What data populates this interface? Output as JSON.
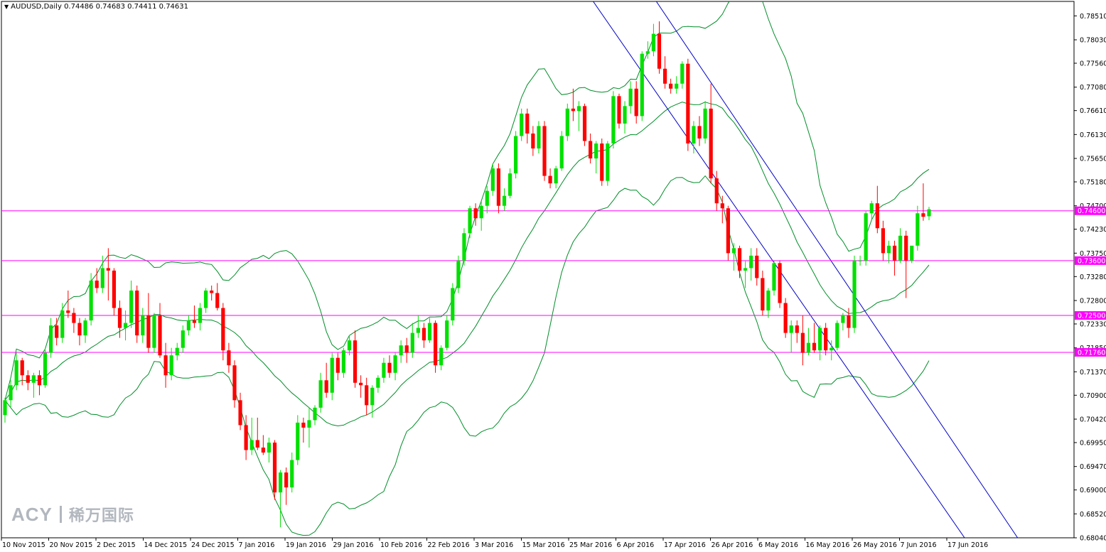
{
  "header": {
    "symbol": "AUDUSD,Daily",
    "ohlc": "0.74486 0.74683 0.74411 0.74631"
  },
  "watermark": {
    "brand": "ACY",
    "chinese": "稀万国际"
  },
  "colors": {
    "bull": "#00e000",
    "bear": "#ff0000",
    "band": "#008e28",
    "channel": "#0000c8",
    "level": "#ff00ff"
  },
  "chart_data": {
    "type": "candlestick",
    "title": "",
    "ylim": [
      0.6804,
      0.788
    ],
    "y_ticks": [
      "0.78510",
      "0.78030",
      "0.77560",
      "0.77080",
      "0.76610",
      "0.76130",
      "0.75650",
      "0.75180",
      "0.74700",
      "0.74230",
      "0.73750",
      "0.73280",
      "0.72800",
      "0.72330",
      "0.71850",
      "0.71370",
      "0.70900",
      "0.70420",
      "0.69950",
      "0.69470",
      "0.69000",
      "0.68520",
      "0.68040"
    ],
    "x_labels": [
      "10 Nov 2015",
      "20 Nov 2015",
      "2 Dec 2015",
      "14 Dec 2015",
      "24 Dec 2015",
      "7 Jan 2016",
      "19 Jan 2016",
      "29 Jan 2016",
      "10 Feb 2016",
      "22 Feb 2016",
      "3 Mar 2016",
      "15 Mar 2016",
      "25 Mar 2016",
      "6 Apr 2016",
      "17 Apr 2016",
      "26 Apr 2016",
      "6 May 2016",
      "16 May 2016",
      "26 May 2016",
      "7 Jun 2016",
      "17 Jun 2016"
    ],
    "horizontal_levels": [
      0.746,
      0.736,
      0.725,
      0.7176
    ],
    "level_labels": [
      "0.74600",
      "0.73600",
      "0.72500",
      "0.71760"
    ],
    "candles": [
      [
        0.705,
        0.7085,
        0.7035,
        0.708
      ],
      [
        0.708,
        0.712,
        0.7065,
        0.711
      ],
      [
        0.711,
        0.7175,
        0.71,
        0.716
      ],
      [
        0.716,
        0.7165,
        0.711,
        0.713
      ],
      [
        0.713,
        0.714,
        0.71,
        0.7115
      ],
      [
        0.7115,
        0.7135,
        0.7085,
        0.713
      ],
      [
        0.713,
        0.714,
        0.709,
        0.711
      ],
      [
        0.711,
        0.7185,
        0.7105,
        0.7175
      ],
      [
        0.7175,
        0.7245,
        0.7165,
        0.723
      ],
      [
        0.723,
        0.7245,
        0.719,
        0.7205
      ],
      [
        0.7205,
        0.7275,
        0.7195,
        0.726
      ],
      [
        0.726,
        0.73,
        0.7245,
        0.7255
      ],
      [
        0.7255,
        0.7265,
        0.7215,
        0.7235
      ],
      [
        0.7235,
        0.7245,
        0.719,
        0.721
      ],
      [
        0.721,
        0.7245,
        0.7195,
        0.724
      ],
      [
        0.724,
        0.7335,
        0.723,
        0.732
      ],
      [
        0.732,
        0.7345,
        0.7295,
        0.7305
      ],
      [
        0.7305,
        0.737,
        0.7295,
        0.7345
      ],
      [
        0.7345,
        0.7385,
        0.728,
        0.734
      ],
      [
        0.734,
        0.7345,
        0.725,
        0.7265
      ],
      [
        0.7265,
        0.728,
        0.7205,
        0.7225
      ],
      [
        0.7225,
        0.726,
        0.72,
        0.7235
      ],
      [
        0.7235,
        0.732,
        0.7225,
        0.73
      ],
      [
        0.73,
        0.731,
        0.7195,
        0.721
      ],
      [
        0.721,
        0.7265,
        0.7195,
        0.725
      ],
      [
        0.725,
        0.7295,
        0.7175,
        0.7185
      ],
      [
        0.7185,
        0.7255,
        0.7175,
        0.725
      ],
      [
        0.725,
        0.7275,
        0.7165,
        0.717
      ],
      [
        0.717,
        0.7195,
        0.7105,
        0.713
      ],
      [
        0.713,
        0.7185,
        0.712,
        0.717
      ],
      [
        0.717,
        0.7195,
        0.716,
        0.7185
      ],
      [
        0.7185,
        0.723,
        0.7175,
        0.722
      ],
      [
        0.722,
        0.725,
        0.721,
        0.724
      ],
      [
        0.724,
        0.727,
        0.7225,
        0.7235
      ],
      [
        0.7235,
        0.7275,
        0.722,
        0.7265
      ],
      [
        0.7265,
        0.7305,
        0.7255,
        0.73
      ],
      [
        0.73,
        0.731,
        0.728,
        0.7295
      ],
      [
        0.7295,
        0.7315,
        0.726,
        0.7265
      ],
      [
        0.7265,
        0.7275,
        0.716,
        0.718
      ],
      [
        0.718,
        0.7195,
        0.7135,
        0.715
      ],
      [
        0.715,
        0.716,
        0.7065,
        0.708
      ],
      [
        0.708,
        0.7095,
        0.702,
        0.703
      ],
      [
        0.703,
        0.705,
        0.696,
        0.698
      ],
      [
        0.698,
        0.7045,
        0.697,
        0.7
      ],
      [
        0.7,
        0.7045,
        0.698,
        0.6985
      ],
      [
        0.6985,
        0.701,
        0.697,
        0.6975
      ],
      [
        0.6975,
        0.7005,
        0.6955,
        0.6995
      ],
      [
        0.6995,
        0.7,
        0.688,
        0.6895
      ],
      [
        0.6895,
        0.694,
        0.6825,
        0.6935
      ],
      [
        0.6935,
        0.6945,
        0.687,
        0.6905
      ],
      [
        0.6905,
        0.6975,
        0.6895,
        0.696
      ],
      [
        0.696,
        0.705,
        0.695,
        0.7035
      ],
      [
        0.7035,
        0.7045,
        0.6995,
        0.7025
      ],
      [
        0.7025,
        0.7065,
        0.6985,
        0.704
      ],
      [
        0.704,
        0.707,
        0.703,
        0.7065
      ],
      [
        0.7065,
        0.7135,
        0.7055,
        0.712
      ],
      [
        0.712,
        0.7155,
        0.7085,
        0.7095
      ],
      [
        0.7095,
        0.7175,
        0.708,
        0.7165
      ],
      [
        0.7165,
        0.7175,
        0.712,
        0.7135
      ],
      [
        0.7135,
        0.7185,
        0.7125,
        0.718
      ],
      [
        0.718,
        0.721,
        0.717,
        0.72
      ],
      [
        0.72,
        0.722,
        0.7105,
        0.7115
      ],
      [
        0.7115,
        0.713,
        0.7085,
        0.711
      ],
      [
        0.711,
        0.7125,
        0.705,
        0.707
      ],
      [
        0.707,
        0.711,
        0.7045,
        0.7105
      ],
      [
        0.7105,
        0.713,
        0.7095,
        0.7125
      ],
      [
        0.7125,
        0.7165,
        0.7115,
        0.7155
      ],
      [
        0.7155,
        0.717,
        0.7125,
        0.7135
      ],
      [
        0.7135,
        0.7175,
        0.712,
        0.717
      ],
      [
        0.717,
        0.72,
        0.7155,
        0.719
      ],
      [
        0.719,
        0.7205,
        0.7155,
        0.7175
      ],
      [
        0.7175,
        0.7235,
        0.7165,
        0.7215
      ],
      [
        0.7215,
        0.725,
        0.7205,
        0.7225
      ],
      [
        0.7225,
        0.7235,
        0.7185,
        0.72
      ],
      [
        0.72,
        0.7245,
        0.7195,
        0.7235
      ],
      [
        0.7235,
        0.724,
        0.7135,
        0.715
      ],
      [
        0.715,
        0.719,
        0.714,
        0.7185
      ],
      [
        0.7185,
        0.725,
        0.718,
        0.724
      ],
      [
        0.724,
        0.7315,
        0.723,
        0.7305
      ],
      [
        0.7305,
        0.737,
        0.7295,
        0.736
      ],
      [
        0.736,
        0.7425,
        0.735,
        0.7415
      ],
      [
        0.7415,
        0.747,
        0.7405,
        0.7465
      ],
      [
        0.7465,
        0.7475,
        0.743,
        0.7445
      ],
      [
        0.7445,
        0.748,
        0.742,
        0.747
      ],
      [
        0.747,
        0.751,
        0.7455,
        0.75
      ],
      [
        0.75,
        0.7555,
        0.749,
        0.7545
      ],
      [
        0.7545,
        0.7555,
        0.7455,
        0.747
      ],
      [
        0.747,
        0.7505,
        0.746,
        0.749
      ],
      [
        0.749,
        0.7545,
        0.7485,
        0.7535
      ],
      [
        0.7535,
        0.762,
        0.7525,
        0.761
      ],
      [
        0.761,
        0.7665,
        0.76,
        0.7655
      ],
      [
        0.7655,
        0.7665,
        0.7595,
        0.7615
      ],
      [
        0.7615,
        0.763,
        0.757,
        0.7585
      ],
      [
        0.7585,
        0.764,
        0.7575,
        0.763
      ],
      [
        0.763,
        0.764,
        0.752,
        0.753
      ],
      [
        0.753,
        0.7545,
        0.7505,
        0.7515
      ],
      [
        0.7515,
        0.755,
        0.7505,
        0.7545
      ],
      [
        0.7545,
        0.762,
        0.754,
        0.761
      ],
      [
        0.761,
        0.7675,
        0.76,
        0.7665
      ],
      [
        0.7665,
        0.7705,
        0.764,
        0.766
      ],
      [
        0.766,
        0.768,
        0.762,
        0.767
      ],
      [
        0.767,
        0.7675,
        0.759,
        0.76
      ],
      [
        0.76,
        0.7615,
        0.7555,
        0.7565
      ],
      [
        0.7565,
        0.76,
        0.7535,
        0.7595
      ],
      [
        0.7595,
        0.7605,
        0.751,
        0.752
      ],
      [
        0.752,
        0.76,
        0.751,
        0.7595
      ],
      [
        0.7595,
        0.77,
        0.7585,
        0.769
      ],
      [
        0.769,
        0.7695,
        0.7625,
        0.7635
      ],
      [
        0.7635,
        0.768,
        0.7615,
        0.767
      ],
      [
        0.767,
        0.772,
        0.7655,
        0.7705
      ],
      [
        0.7705,
        0.772,
        0.7635,
        0.765
      ],
      [
        0.765,
        0.778,
        0.764,
        0.7775
      ],
      [
        0.7775,
        0.78,
        0.7765,
        0.778
      ],
      [
        0.778,
        0.7835,
        0.777,
        0.7815
      ],
      [
        0.7815,
        0.784,
        0.7735,
        0.7745
      ],
      [
        0.7745,
        0.777,
        0.7705,
        0.7715
      ],
      [
        0.7715,
        0.7725,
        0.7695,
        0.7705
      ],
      [
        0.7705,
        0.773,
        0.7695,
        0.7715
      ],
      [
        0.7715,
        0.776,
        0.7705,
        0.7755
      ],
      [
        0.7755,
        0.7765,
        0.758,
        0.7595
      ],
      [
        0.7595,
        0.764,
        0.7575,
        0.763
      ],
      [
        0.763,
        0.765,
        0.759,
        0.7605
      ],
      [
        0.7605,
        0.768,
        0.7595,
        0.7665
      ],
      [
        0.7665,
        0.7715,
        0.7515,
        0.7525
      ],
      [
        0.7525,
        0.754,
        0.746,
        0.7475
      ],
      [
        0.7475,
        0.749,
        0.7435,
        0.7465
      ],
      [
        0.7465,
        0.747,
        0.736,
        0.7375
      ],
      [
        0.7375,
        0.7395,
        0.734,
        0.7385
      ],
      [
        0.7385,
        0.739,
        0.7325,
        0.734
      ],
      [
        0.734,
        0.736,
        0.7305,
        0.7345
      ],
      [
        0.7345,
        0.7385,
        0.732,
        0.737
      ],
      [
        0.737,
        0.7385,
        0.731,
        0.7325
      ],
      [
        0.7325,
        0.734,
        0.725,
        0.726
      ],
      [
        0.726,
        0.7305,
        0.7245,
        0.73
      ],
      [
        0.73,
        0.736,
        0.729,
        0.7355
      ],
      [
        0.7355,
        0.736,
        0.7265,
        0.7275
      ],
      [
        0.7275,
        0.7285,
        0.7205,
        0.7215
      ],
      [
        0.7215,
        0.724,
        0.7175,
        0.723
      ],
      [
        0.723,
        0.724,
        0.7195,
        0.7215
      ],
      [
        0.7215,
        0.725,
        0.715,
        0.7175
      ],
      [
        0.7175,
        0.7225,
        0.717,
        0.7195
      ],
      [
        0.7195,
        0.7235,
        0.7175,
        0.718
      ],
      [
        0.718,
        0.723,
        0.716,
        0.7225
      ],
      [
        0.7225,
        0.7235,
        0.717,
        0.718
      ],
      [
        0.718,
        0.72,
        0.716,
        0.7185
      ],
      [
        0.7185,
        0.724,
        0.718,
        0.7235
      ],
      [
        0.7235,
        0.7255,
        0.722,
        0.725
      ],
      [
        0.725,
        0.7265,
        0.7205,
        0.7225
      ],
      [
        0.7225,
        0.737,
        0.7215,
        0.736
      ],
      [
        0.736,
        0.737,
        0.735,
        0.736
      ],
      [
        0.736,
        0.746,
        0.735,
        0.7455
      ],
      [
        0.7455,
        0.748,
        0.744,
        0.7475
      ],
      [
        0.7475,
        0.751,
        0.7415,
        0.7425
      ],
      [
        0.7425,
        0.744,
        0.736,
        0.7375
      ],
      [
        0.7375,
        0.74,
        0.7355,
        0.739
      ],
      [
        0.739,
        0.74,
        0.733,
        0.736
      ],
      [
        0.736,
        0.7425,
        0.7355,
        0.741
      ],
      [
        0.741,
        0.742,
        0.7285,
        0.736
      ],
      [
        0.736,
        0.7385,
        0.7355,
        0.739
      ],
      [
        0.739,
        0.747,
        0.738,
        0.7455
      ],
      [
        0.7455,
        0.7515,
        0.744,
        0.7448
      ],
      [
        0.7449,
        0.7468,
        0.7441,
        0.7463
      ]
    ]
  }
}
